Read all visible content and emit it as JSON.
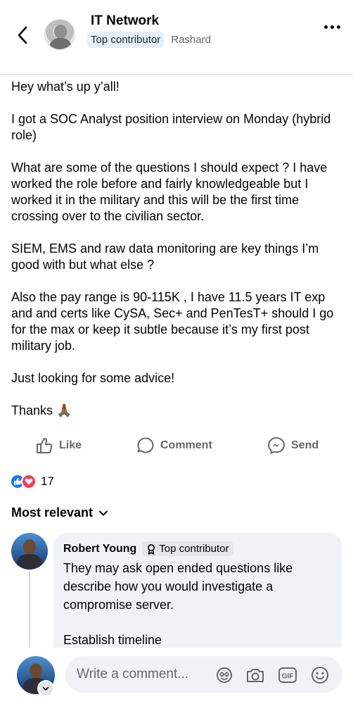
{
  "header": {
    "group_name": "IT Network",
    "badge": "Top contributor",
    "author": "Rashard"
  },
  "post": {
    "paragraphs": [
      "Hey what’s up y’all!",
      "I got a SOC Analyst position interview on Monday (hybrid role)",
      "What are some of the questions I should expect ? I have worked the role before and fairly knowledgeable but I worked it in the military and this will be the first time crossing over to the civilian sector.",
      "SIEM, EMS and raw data monitoring are key things I’m good with but what else ?",
      "Also the pay range is 90-115K , I have 11.5 years IT exp and and certs like CySA, Sec+ and PenTesT+ should I go for the max or keep it subtle because it’s my first post military job.",
      "Just looking for some advice!",
      "Thanks 🙏🏾"
    ]
  },
  "actions": {
    "like": "Like",
    "comment": "Comment",
    "send": "Send"
  },
  "reactions": {
    "count": "17"
  },
  "sort": {
    "label": "Most relevant"
  },
  "comment": {
    "name": "Robert Young",
    "badge": "Top contributor",
    "paragraphs": [
      "They may ask open ended questions like describe how you would investigate a compromise server.",
      "Establish timeline"
    ]
  },
  "composer": {
    "placeholder": "Write a comment..."
  },
  "colors": {
    "accent": "#1877f2",
    "love": "#f33e58",
    "muted": "#65676b",
    "bubble": "#f0f2f5"
  }
}
